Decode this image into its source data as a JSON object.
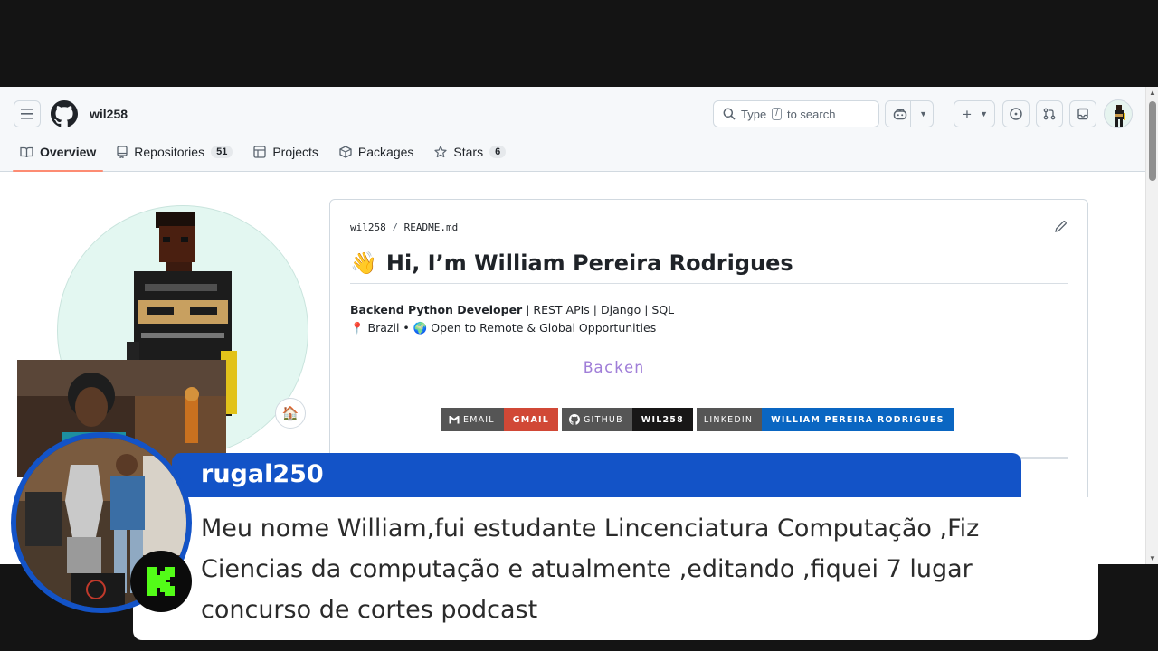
{
  "app": {
    "owner": "wil258",
    "search_prefix": "Type",
    "search_key": "/",
    "search_suffix": "to search"
  },
  "tabs": [
    {
      "label": "Overview",
      "icon": "book-icon",
      "active": true
    },
    {
      "label": "Repositories",
      "icon": "repo-icon",
      "count": "51"
    },
    {
      "label": "Projects",
      "icon": "table-icon"
    },
    {
      "label": "Packages",
      "icon": "package-icon"
    },
    {
      "label": "Stars",
      "icon": "star-icon",
      "count": "6"
    }
  ],
  "readme": {
    "path_user": "wil258",
    "path_sep": "/",
    "path_file": "README.md",
    "title": "Hi, I’m William Pereira Rodrigues",
    "wave": "👋",
    "role_bold": "Backend Python Developer",
    "role_rest": " | REST APIs | Django | SQL",
    "location": "📍 Brazil • 🌍 Open to Remote & Global Opportunities",
    "typing_text": "Backen",
    "badges": [
      {
        "left": "EMAIL",
        "right": "GMAIL",
        "color": "#d14836",
        "icon": "gmail-icon"
      },
      {
        "left": "GITHUB",
        "right": "WIL258",
        "color": "#181717",
        "icon": "github-icon"
      },
      {
        "left": "LINKEDIN",
        "right": "WILLIAM PEREIRA RODRIGUES",
        "color": "#0a66c2",
        "icon": ""
      }
    ]
  },
  "status_emoji": "🏠",
  "chat": {
    "username": "rugal250",
    "message": "Meu nome William,fui estudante Lincenciatura Computação ,Fiz Ciencias da computação e atualmente ,editando ,fiquei 7 lugar concurso de cortes podcast"
  },
  "colors": {
    "accent_tab": "#fd8c73",
    "chat_blue": "#1353c7",
    "kick_green": "#53fc18"
  }
}
